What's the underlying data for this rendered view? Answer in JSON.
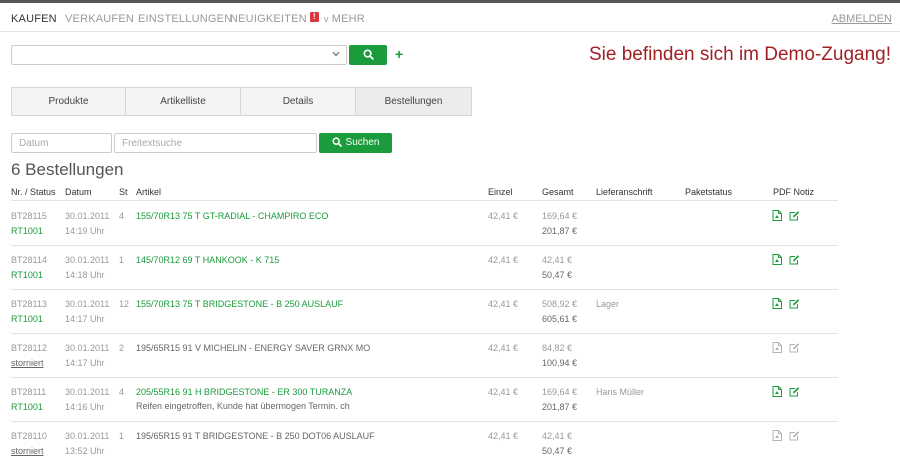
{
  "nav": {
    "items": [
      {
        "label": "KAUFEN"
      },
      {
        "label": "VERKAUFEN"
      },
      {
        "label": "EINSTELLUNGEN"
      },
      {
        "label": "NEUIGKEITEN"
      },
      {
        "label": "MEHR"
      }
    ],
    "news_badge": "!",
    "more_chevron": "v",
    "logout": "ABMELDEN"
  },
  "search": {
    "select_value": "",
    "plus": "+"
  },
  "demo_notice": "Sie befinden sich im Demo-Zugang!",
  "tabs": [
    "Produkte",
    "Artikelliste",
    "Details",
    "Bestellungen"
  ],
  "filter": {
    "date_placeholder": "Datum",
    "text_placeholder": "Freitextsuche",
    "search_label": "Suchen"
  },
  "orders_title": "6 Bestellungen",
  "table": {
    "headers": [
      "Nr. / Status",
      "Datum",
      "St",
      "Artikel",
      "Einzel",
      "Gesamt",
      "Lieferanschrift",
      "Paketstatus",
      "PDF Notiz"
    ],
    "rows": [
      {
        "nr": "BT28115",
        "status": "RT1001",
        "date": "30.01.2011",
        "time": "14:19 Uhr",
        "qty": "4",
        "article": "155/70R13 75 T GT-RADIAL - CHAMPIRO ECO",
        "note": "",
        "single": "42,41 €",
        "total": "169,64 €",
        "grand": "201,87 €",
        "address": "",
        "package": ""
      },
      {
        "nr": "BT28114",
        "status": "RT1001",
        "date": "30.01.2011",
        "time": "14:18 Uhr",
        "qty": "1",
        "article": "145/70R12 69 T HANKOOK - K 715",
        "note": "",
        "single": "42,41 €",
        "total": "42,41 €",
        "grand": "50,47 €",
        "address": "",
        "package": ""
      },
      {
        "nr": "BT28113",
        "status": "RT1001",
        "date": "30.01.2011",
        "time": "14:17 Uhr",
        "qty": "12",
        "article": "155/70R13 75 T BRIDGESTONE - B 250 AUSLAUF",
        "note": "",
        "single": "42,41 €",
        "total": "508,92 €",
        "grand": "605,61 €",
        "address": "Lager",
        "package": ""
      },
      {
        "nr": "BT28112",
        "status": "storniert",
        "date": "30.01.2011",
        "time": "14:17 Uhr",
        "qty": "2",
        "article": "195/65R15 91 V MICHELIN - ENERGY SAVER GRNX MO",
        "note": "",
        "single": "42,41 €",
        "total": "84,82 €",
        "grand": "100,94 €",
        "address": "",
        "package": ""
      },
      {
        "nr": "BT28111",
        "status": "RT1001",
        "date": "30.01.2011",
        "time": "14:16 Uhr",
        "qty": "4",
        "article": "205/55R16 91 H BRIDGESTONE - ER 300 TURANZA",
        "note": "Reifen eingetroffen, Kunde hat übermogen Termin. ch",
        "single": "42,41 €",
        "total": "169,64 €",
        "grand": "201,87 €",
        "address": "Hans Müller",
        "package": ""
      },
      {
        "nr": "BT28110",
        "status": "storniert",
        "date": "30.01.2011",
        "time": "13:52 Uhr",
        "qty": "1",
        "article": "195/65R15 91 T BRIDGESTONE - B 250 DOT06 AUSLAUF",
        "note": "",
        "single": "42,41 €",
        "total": "42,41 €",
        "grand": "50,47 €",
        "address": "",
        "package": ""
      }
    ]
  },
  "colors": {
    "accent_green": "#1a9b3c",
    "demo_red": "#a21f24",
    "badge_red": "#d9363e"
  }
}
